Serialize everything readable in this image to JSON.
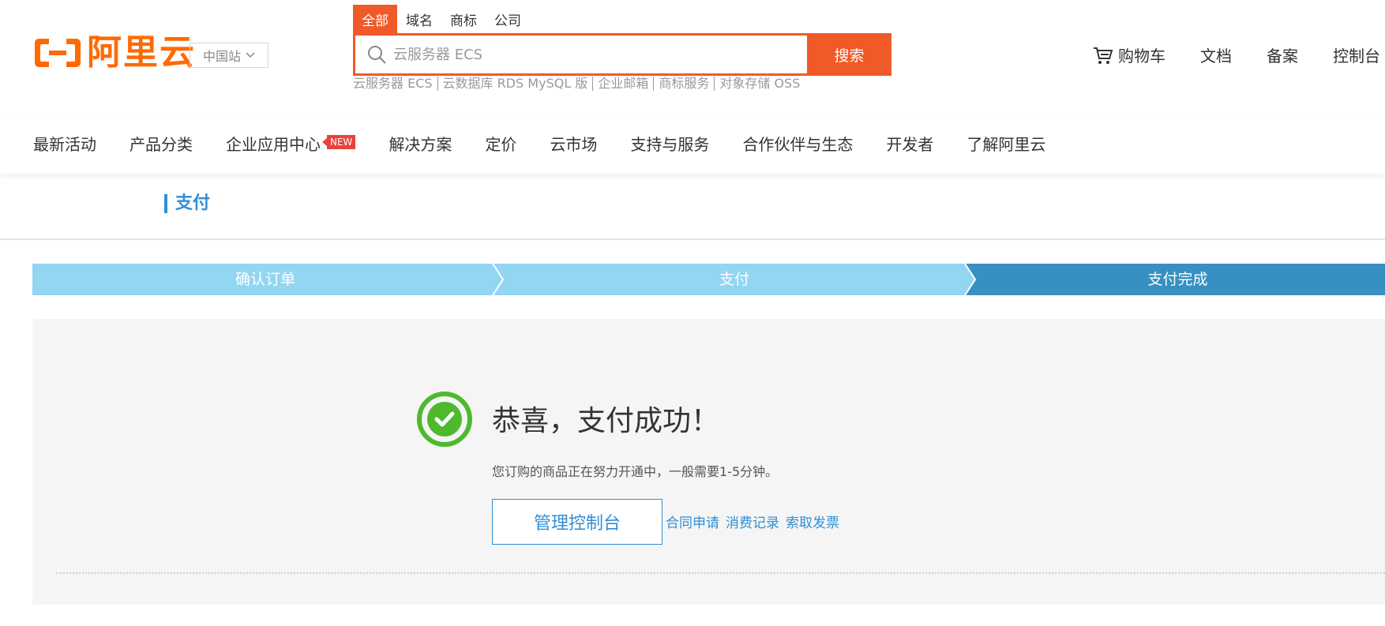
{
  "brand": {
    "logo_text": "阿里云",
    "site_select": "中国站"
  },
  "search": {
    "tabs": [
      {
        "label": "全部",
        "active": true
      },
      {
        "label": "域名",
        "active": false
      },
      {
        "label": "商标",
        "active": false
      },
      {
        "label": "公司",
        "active": false
      }
    ],
    "placeholder": "云服务器 ECS",
    "button": "搜索",
    "hot": [
      "云服务器 ECS",
      "云数据库 RDS MySQL 版",
      "企业邮箱",
      "商标服务",
      "对象存储 OSS"
    ]
  },
  "top_links": {
    "cart": "购物车",
    "docs": "文档",
    "icp": "备案",
    "console": "控制台"
  },
  "nav": {
    "items": [
      {
        "label": "最新活动"
      },
      {
        "label": "产品分类"
      },
      {
        "label": "企业应用中心",
        "badge": "NEW"
      },
      {
        "label": "解决方案"
      },
      {
        "label": "定价"
      },
      {
        "label": "云市场"
      },
      {
        "label": "支持与服务"
      },
      {
        "label": "合作伙伴与生态"
      },
      {
        "label": "开发者"
      },
      {
        "label": "了解阿里云"
      }
    ]
  },
  "page": {
    "title": "支付"
  },
  "steps": [
    {
      "label": "确认订单",
      "state": "done"
    },
    {
      "label": "支付",
      "state": "done"
    },
    {
      "label": "支付完成",
      "state": "current"
    }
  ],
  "result": {
    "title": "恭喜，支付成功！",
    "desc": "您订购的商品正在努力开通中，一般需要1-5分钟。",
    "console_button": "管理控制台",
    "links": [
      "合同申请",
      "消费记录",
      "索取发票"
    ]
  },
  "colors": {
    "brand_orange": "#ff6a00",
    "search_orange": "#f05a28",
    "link_blue": "#2f8fd6",
    "step_done": "#92d6f2",
    "step_current": "#3790c1",
    "success_green": "#4fb92e"
  }
}
